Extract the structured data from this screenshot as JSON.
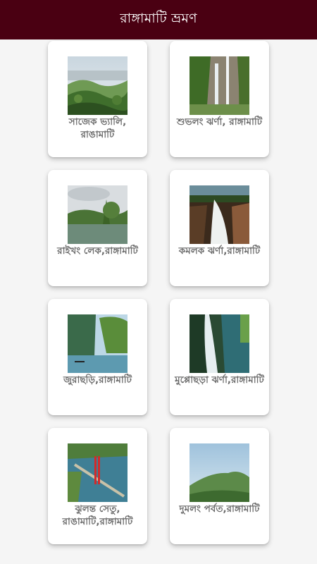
{
  "app": {
    "title": "রাঙ্গামাটি ভ্রমণ"
  },
  "places": [
    {
      "name": "সাজেক ভ্যালি, রাঙামাটি",
      "image": "sajek-valley-photo"
    },
    {
      "name": "শুভলং ঝর্ণা, রাঙ্গামাটি",
      "image": "shuvolong-waterfall-photo"
    },
    {
      "name": "রাইখং লেক,রাঙ্গামাটি",
      "image": "raikhong-lake-photo"
    },
    {
      "name": "কমলক ঝর্ণা,রাঙ্গামাটি",
      "image": "komolok-waterfall-photo"
    },
    {
      "name": "জুরাছড়ি,রাঙ্গামাটি",
      "image": "jurachari-lake-photo"
    },
    {
      "name": "মুপ্পোছড়া ঝর্ণা,রাঙ্গামাটি",
      "image": "muppochora-waterfall-photo"
    },
    {
      "name": "ঝুলন্ত সেতু, রাঙামাটি,রাঙ্গামাটি",
      "image": "hanging-bridge-photo"
    },
    {
      "name": "দুমলং পর্বত,রাঙ্গামাটি",
      "image": "dumlong-mountain-photo"
    }
  ],
  "colors": {
    "appbar": "#4a0012",
    "label": "#6b6b6b",
    "background": "#f5f5f5"
  }
}
